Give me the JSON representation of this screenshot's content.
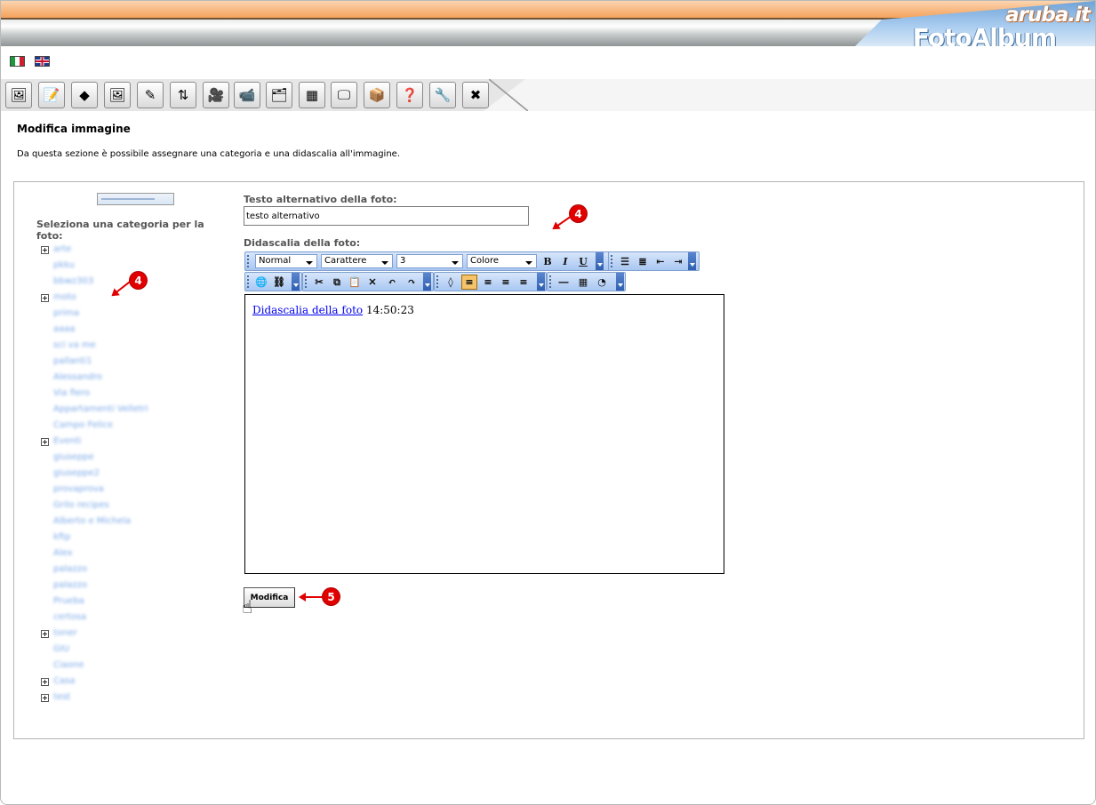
{
  "header": {
    "brand_top": "aruba.it",
    "brand_main": "FotoAlbum"
  },
  "languages": [
    {
      "name": "italian-flag-icon",
      "colors": [
        "#1a9a3a",
        "#ffffff",
        "#d02030"
      ]
    },
    {
      "name": "english-flag-icon",
      "colors": [
        "#1f3a8a",
        "#ffffff",
        "#c8102e"
      ]
    }
  ],
  "toolbar_icons": [
    "edit-album-icon",
    "edit-page-icon",
    "eraser-icon",
    "add-image-icon",
    "edit-image-icon",
    "sort-icon",
    "add-video-icon",
    "edit-video-icon",
    "image-categories-icon",
    "structure-icon",
    "slideshow-icon",
    "package-icon",
    "help-icon",
    "tools-icon",
    "close-icon"
  ],
  "page": {
    "title": "Modifica immagine",
    "description": "Da questa sezione è possibile assegnare una categoria e una didascalia all'immagine."
  },
  "categories": {
    "heading": "Seleziona una categoria per la foto:",
    "items": [
      {
        "label": "arte",
        "expandable": true
      },
      {
        "label": "pkku",
        "expandable": false
      },
      {
        "label": "bbwz303",
        "expandable": false
      },
      {
        "label": "moto",
        "expandable": true
      },
      {
        "label": "prima",
        "expandable": false
      },
      {
        "label": "aaaa",
        "expandable": false
      },
      {
        "label": "sci va me",
        "expandable": false
      },
      {
        "label": "pallanti1",
        "expandable": false
      },
      {
        "label": "Alessandro",
        "expandable": false
      },
      {
        "label": "Via fiero",
        "expandable": false
      },
      {
        "label": "Appartamenti Velletri",
        "expandable": false
      },
      {
        "label": "Campo Felice",
        "expandable": false
      },
      {
        "label": "Eventi",
        "expandable": true
      },
      {
        "label": "giuseppe",
        "expandable": false
      },
      {
        "label": "giuseppe2",
        "expandable": false
      },
      {
        "label": "provaprova",
        "expandable": false
      },
      {
        "label": "Grilo recipes",
        "expandable": false
      },
      {
        "label": "Alberto e Michela",
        "expandable": false
      },
      {
        "label": "kftp",
        "expandable": false
      },
      {
        "label": "Alex",
        "expandable": false
      },
      {
        "label": "palazzo",
        "expandable": false
      },
      {
        "label": "palazzo",
        "expandable": false
      },
      {
        "label": "Prueba",
        "expandable": false
      },
      {
        "label": "certosa",
        "expandable": false
      },
      {
        "label": "toner",
        "expandable": true
      },
      {
        "label": "GIU",
        "expandable": false
      },
      {
        "label": "Ciaone",
        "expandable": false
      },
      {
        "label": "Casa",
        "expandable": true
      },
      {
        "label": "test",
        "expandable": true
      }
    ]
  },
  "form": {
    "alt_label": "Testo alternativo della foto:",
    "alt_value": "testo alternativo",
    "caption_label": "Didascalia della foto:",
    "editor": {
      "format": "Normal",
      "font": "Carattere",
      "size": "3",
      "color": "Colore",
      "bold": "B",
      "italic": "I",
      "underline": "U"
    },
    "caption_link": "Didascalia della foto",
    "caption_time": "14:50:23",
    "submit": "Modifica"
  },
  "annotations": {
    "step_alt": "4",
    "step_categories": "4",
    "step_submit": "5"
  },
  "colors": {
    "accent_orange": "#f5a25c",
    "annotation_red": "#e00000",
    "link_blue": "#0000ee",
    "editor_toolbar": "#a9c7f2"
  }
}
